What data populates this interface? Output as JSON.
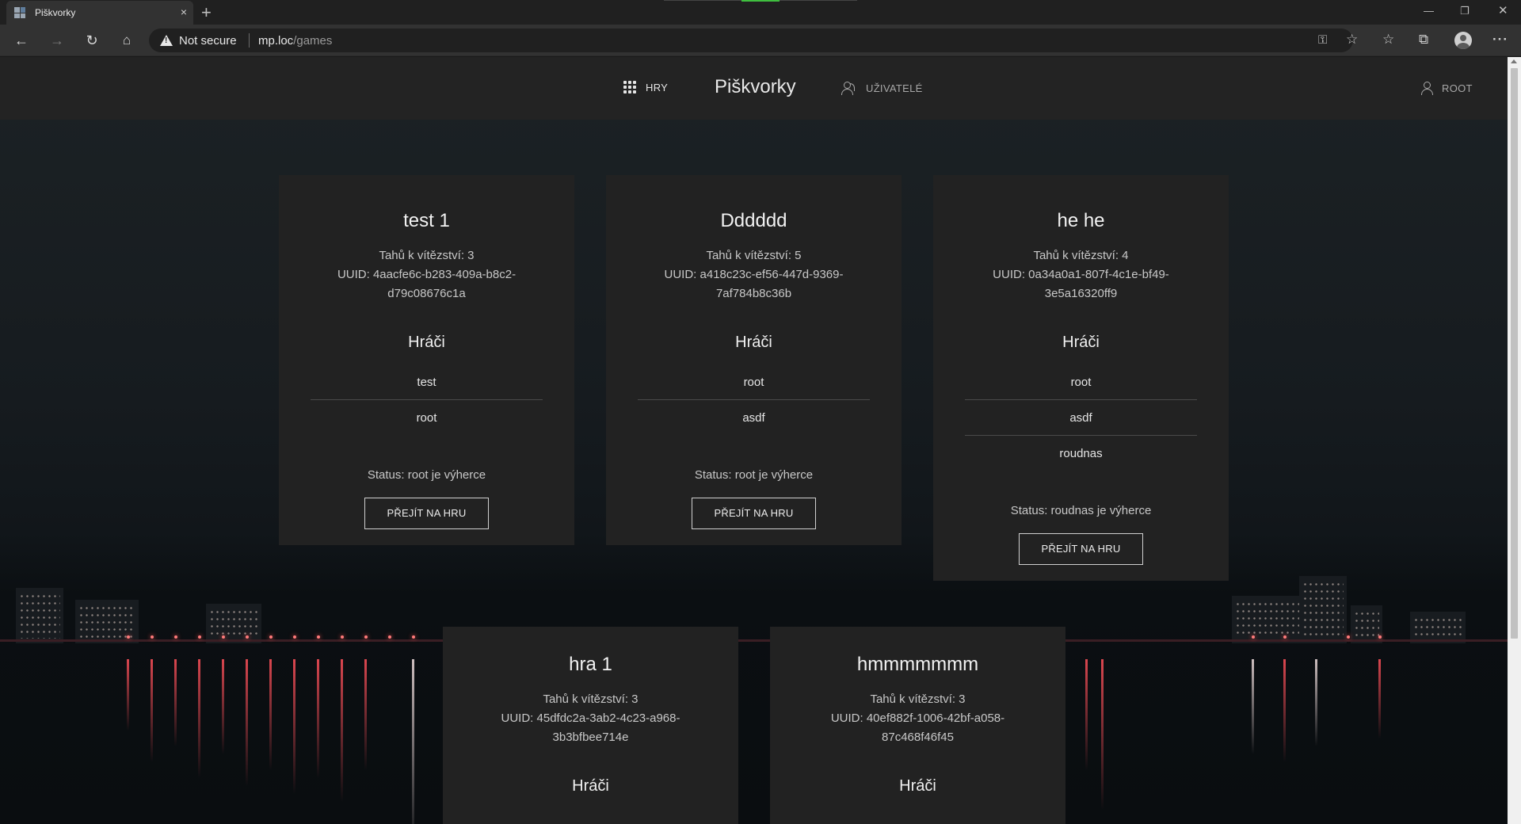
{
  "browser": {
    "tab_title": "Piškvorky",
    "tab_close": "×",
    "new_tab": "+",
    "security_label": "Not secure",
    "url_host": "mp.loc",
    "url_path": "/games",
    "icons": [
      "back-icon",
      "forward-icon",
      "refresh-icon",
      "home-icon",
      "key-icon",
      "favorite-add-icon",
      "favorites-icon",
      "collections-icon",
      "profile-icon",
      "more-icon"
    ]
  },
  "nav": {
    "games_label": "HRY",
    "brand": "Piškvorky",
    "users_label": "UŽIVATELÉ",
    "account_label": "ROOT"
  },
  "labels": {
    "moves_prefix": "Tahů k vítězství:",
    "uuid_prefix": "UUID:",
    "players_heading": "Hráči",
    "status_prefix": "Status:",
    "go_button": "PŘEJÍT NA HRU"
  },
  "games": [
    {
      "title": "test 1",
      "moves": "Tahů k vítězství: 3",
      "uuid": "UUID: 4aacfe6c-b283-409a-b8c2-d79c08676c1a",
      "players": [
        "test",
        "root"
      ],
      "status": "Status: root je výherce"
    },
    {
      "title": "Dddddd",
      "moves": "Tahů k vítězství: 5",
      "uuid": "UUID: a418c23c-ef56-447d-9369-7af784b8c36b",
      "players": [
        "root",
        "asdf"
      ],
      "status": "Status: root je výherce"
    },
    {
      "title": "he he",
      "moves": "Tahů k vítězství: 4",
      "uuid": "UUID: 0a34a0a1-807f-4c1e-bf49-3e5a16320ff9",
      "players": [
        "root",
        "asdf",
        "roudnas"
      ],
      "status": "Status: roudnas je výherce"
    },
    {
      "title": "hra 1",
      "moves": "Tahů k vítězství: 3",
      "uuid": "UUID: 45dfdc2a-3ab2-4c23-a968-3b3bfbee714e",
      "players": [],
      "status": ""
    },
    {
      "title": "hmmmmmmm",
      "moves": "Tahů k vítězství: 3",
      "uuid": "UUID: 40ef882f-1006-42bf-a058-87c468f46f45",
      "players": [],
      "status": ""
    }
  ],
  "colors": {
    "card_bg": "#222222",
    "nav_bg": "#232323",
    "text": "#dcdcdc"
  }
}
